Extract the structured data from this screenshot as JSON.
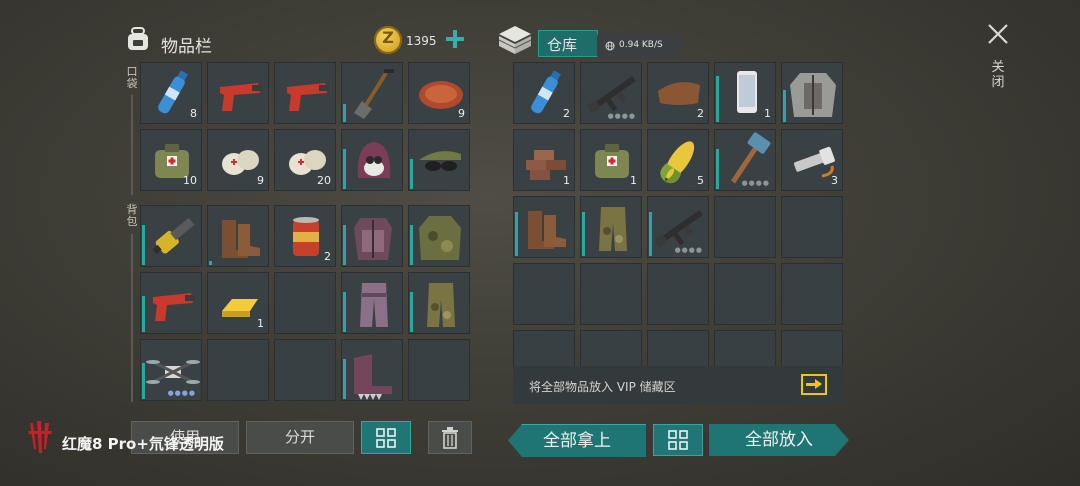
{
  "inventory": {
    "title": "物品栏",
    "coins": "1395",
    "pocket_label": "口袋",
    "backpack_label": "背包",
    "pocket_slots": [
      {
        "icon": "water-bottle-icon",
        "count": "8"
      },
      {
        "icon": "flare-gun-icon",
        "count": ""
      },
      {
        "icon": "flare-gun-icon",
        "count": ""
      },
      {
        "icon": "shovel-icon",
        "count": ""
      },
      {
        "icon": "meat-icon",
        "count": "9"
      },
      {
        "icon": "medkit-bag-icon",
        "count": "10"
      },
      {
        "icon": "bandage-icon",
        "count": "9"
      },
      {
        "icon": "bandage-icon",
        "count": "20"
      },
      {
        "icon": "gas-mask-hood-icon",
        "count": ""
      },
      {
        "icon": "cap-sunglasses-icon",
        "count": ""
      }
    ],
    "backpack_slots": [
      {
        "icon": "chainsaw-icon",
        "count": ""
      },
      {
        "icon": "boots-icon",
        "count": ""
      },
      {
        "icon": "food-can-icon",
        "count": "2"
      },
      {
        "icon": "armor-vest-icon",
        "count": ""
      },
      {
        "icon": "camo-jacket-icon",
        "count": ""
      },
      {
        "icon": "flare-gun-icon",
        "count": ""
      },
      {
        "icon": "gold-bar-icon",
        "count": "1"
      },
      {
        "icon": "",
        "count": ""
      },
      {
        "icon": "armored-pants-icon",
        "count": ""
      },
      {
        "icon": "camo-pants-icon",
        "count": ""
      },
      {
        "icon": "drone-icon",
        "count": ""
      },
      {
        "icon": "",
        "count": ""
      },
      {
        "icon": "",
        "count": ""
      },
      {
        "icon": "spiked-boots-icon",
        "count": ""
      },
      {
        "icon": "",
        "count": ""
      }
    ]
  },
  "storage": {
    "title": "仓库",
    "network_speed": "0.94 KB/S",
    "slots": [
      {
        "icon": "water-bottle-icon",
        "count": "2"
      },
      {
        "icon": "assault-rifle-icon",
        "count": ""
      },
      {
        "icon": "leather-icon",
        "count": "2"
      },
      {
        "icon": "smartphone-icon",
        "count": "1"
      },
      {
        "icon": "armor-jacket-icon",
        "count": ""
      },
      {
        "icon": "bricks-icon",
        "count": "1"
      },
      {
        "icon": "medkit-bag-icon",
        "count": "1"
      },
      {
        "icon": "corn-icon",
        "count": "5"
      },
      {
        "icon": "sledgehammer-icon",
        "count": ""
      },
      {
        "icon": "flashlight-icon",
        "count": "3"
      },
      {
        "icon": "boots-icon",
        "count": ""
      },
      {
        "icon": "camo-pants-icon",
        "count": ""
      },
      {
        "icon": "assault-rifle-icon",
        "count": ""
      }
    ],
    "vip_text": "将全部物品放入 VIP 储藏区"
  },
  "buttons": {
    "use": "使用",
    "split": "分开",
    "take_all": "全部拿上",
    "put_all": "全部放入"
  },
  "close_label": "关闭",
  "watermark": "红魔8 Pro+氘锋透明版",
  "colors": {
    "accent": "#2aa7a5",
    "coin": "#e2b62a",
    "vip_arrow": "#f0c419"
  }
}
